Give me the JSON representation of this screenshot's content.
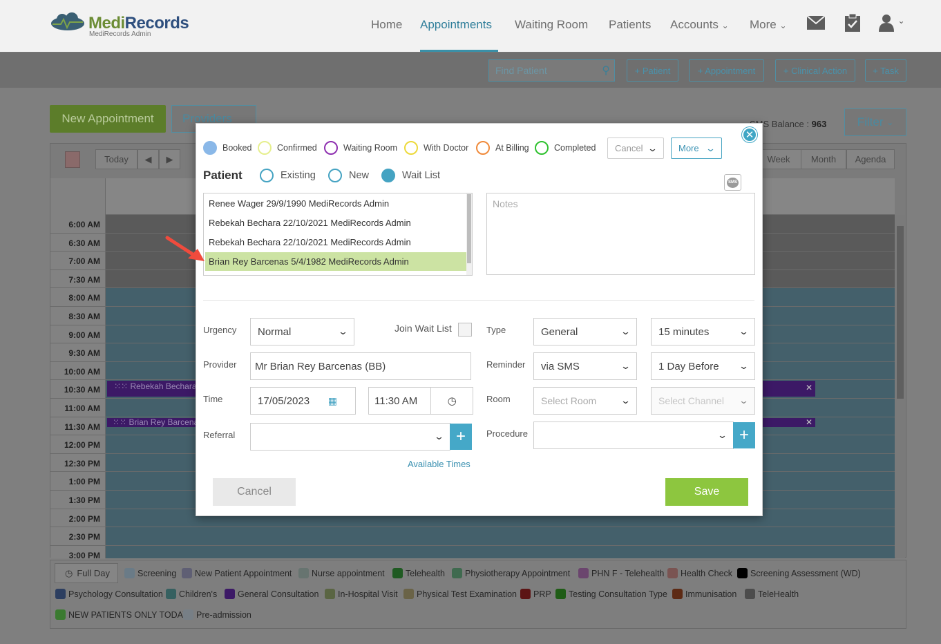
{
  "brand": {
    "name_part1": "Medi",
    "name_part2": "Records",
    "subtitle": "MediRecords Admin"
  },
  "nav": {
    "home": "Home",
    "appointments": "Appointments",
    "waiting_room": "Waiting Room",
    "patients": "Patients",
    "accounts": "Accounts",
    "more": "More"
  },
  "subbar": {
    "find_placeholder": "Find Patient",
    "add_patient": "+ Patient",
    "add_appointment": "+ Appointment",
    "add_clinical_action": "+ Clinical Action",
    "add_task": "+ Task"
  },
  "page": {
    "new_appointment": "New Appointment",
    "providers": "Providers",
    "filter": "Filter",
    "sms_balance_label": "SMS Balance :",
    "sms_balance_value": "963"
  },
  "calendar": {
    "today": "Today",
    "views": [
      "Week",
      "Month",
      "Agenda"
    ],
    "times": [
      "6:00 AM",
      "6:30 AM",
      "7:00 AM",
      "7:30 AM",
      "8:00 AM",
      "8:30 AM",
      "9:00 AM",
      "9:30 AM",
      "10:00 AM",
      "10:30 AM",
      "11:00 AM",
      "11:30 AM",
      "12:00 PM",
      "12:30 PM",
      "1:00 PM",
      "1:30 PM",
      "2:00 PM",
      "2:30 PM",
      "3:00 PM"
    ],
    "appointments": [
      {
        "name": "Rebekah Bechara"
      },
      {
        "name": "Brian Rey Barcenas"
      }
    ]
  },
  "legend": {
    "full_day": "Full Day",
    "items": [
      {
        "label": "Screening",
        "color": "#6a7b87"
      },
      {
        "label": "New Patient Appointment",
        "color": "#5f5f74"
      },
      {
        "label": "Nurse appointment",
        "color": "#677470"
      },
      {
        "label": "Telehealth",
        "color": "#1f5a22"
      },
      {
        "label": "Physiotherapy Appointment",
        "color": "#3f6a4f"
      },
      {
        "label": "PHN F - Telehealth",
        "color": "#6b456e"
      },
      {
        "label": "Health Check",
        "color": "#7a5452"
      },
      {
        "label": "Screening Assessment (WD)",
        "color": "#000000"
      },
      {
        "label": "Psychology Consultation",
        "color": "#2c3e60"
      },
      {
        "label": "Children's",
        "color": "#366060"
      },
      {
        "label": "General Consultation",
        "color": "#3c1966"
      },
      {
        "label": "In-Hospital Visit",
        "color": "#5a6543"
      },
      {
        "label": "Physical Test Examination",
        "color": "#6a6347"
      },
      {
        "label": "PRP",
        "color": "#5c1414"
      },
      {
        "label": "Testing Consultation Type",
        "color": "#1f5c16"
      },
      {
        "label": "Immunisation",
        "color": "#5d2a14"
      },
      {
        "label": "TeleHealth",
        "color": "#4c4c4c"
      },
      {
        "label": "NEW PATIENTS ONLY TODAY",
        "color": "#3a7a30"
      },
      {
        "label": "Pre-admission",
        "color": "#777f86"
      }
    ]
  },
  "modal": {
    "statuses": [
      {
        "label": "Booked",
        "color": "#8ab8e8",
        "filled": true
      },
      {
        "label": "Confirmed",
        "color": "#e6ef8e",
        "filled": false
      },
      {
        "label": "Waiting Room",
        "color": "#8e2fb0",
        "filled": false
      },
      {
        "label": "With Doctor",
        "color": "#ecd93a",
        "filled": false
      },
      {
        "label": "At Billing",
        "color": "#f08a3a",
        "filled": false
      },
      {
        "label": "Completed",
        "color": "#2ec12e",
        "filled": false
      }
    ],
    "cancel_dropdown": "Cancel",
    "more_dropdown": "More",
    "patient_label": "Patient",
    "patient_types": [
      {
        "label": "Existing",
        "selected": false
      },
      {
        "label": "New",
        "selected": false
      },
      {
        "label": "Wait List",
        "selected": true
      }
    ],
    "patient_list": [
      "Renee Wager 29/9/1990 MediRecords Admin",
      "Rebekah Bechara 22/10/2021 MediRecords Admin",
      "Rebekah Bechara 22/10/2021 MediRecords Admin",
      "Brian Rey Barcenas 5/4/1982 MediRecords Admin"
    ],
    "selected_patient_index": 3,
    "notes_placeholder": "Notes",
    "sms_icon": "SMS",
    "urgency_label": "Urgency",
    "urgency_value": "Normal",
    "join_wait_list_label": "Join Wait List",
    "type_label": "Type",
    "type_value": "General",
    "duration_value": "15 minutes",
    "provider_label": "Provider",
    "provider_value": "Mr Brian Rey Barcenas (BB)",
    "reminder_label": "Reminder",
    "reminder_value": "via SMS",
    "reminder_when": "1 Day Before",
    "time_label": "Time",
    "date_value": "17/05/2023",
    "time_value": "11:30 AM",
    "room_label": "Room",
    "room_placeholder": "Select Room",
    "channel_placeholder": "Select Channel",
    "referral_label": "Referral",
    "procedure_label": "Procedure",
    "available_times": "Available Times",
    "cancel_button": "Cancel",
    "save_button": "Save"
  },
  "annotation": {
    "arrow_color": "#f04b3d"
  }
}
